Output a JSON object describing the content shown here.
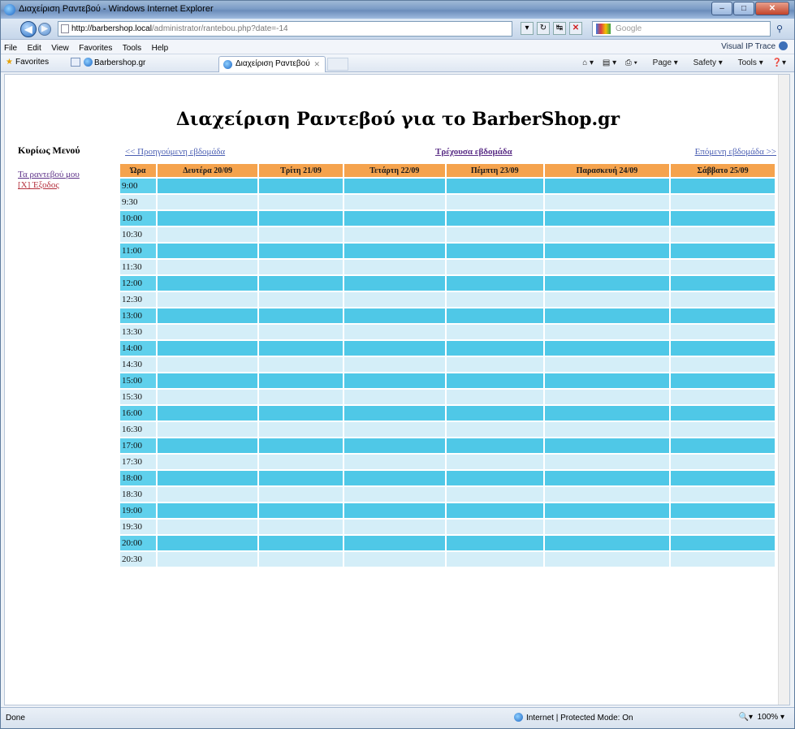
{
  "browser": {
    "window_title": "Διαχείριση Ραντεβού - Windows Internet Explorer",
    "address_host": "http://barbershop.local",
    "address_path": "/administrator/rantebou.php?date=-14",
    "search_placeholder": "Google",
    "menu": [
      "File",
      "Edit",
      "View",
      "Favorites",
      "Tools",
      "Help"
    ],
    "visual_ip_trace": "Visual IP Trace",
    "favorites_label": "Favorites",
    "fav_site": "Barbershop.gr",
    "tab_title": "Διαχείριση Ραντεβού",
    "cmd_page": "Page",
    "cmd_safety": "Safety",
    "cmd_tools": "Tools",
    "status_done": "Done",
    "status_zone": "Internet | Protected Mode: On",
    "zoom": "100%"
  },
  "page": {
    "title": "Διαχείριση Ραντεβού για το BarberShop.gr",
    "side_menu": {
      "header": "Κυρίως Μενού",
      "my_appointments": "Τα ραντεβού μου",
      "exit": "[X] Έξοδος"
    },
    "week_nav": {
      "prev": "<< Προηγούμενη εβδομάδα",
      "current": "Τρέχουσα εβδομάδα",
      "next": "Επόμενη εβδομάδα >>"
    },
    "schedule": {
      "time_header": "Ώρα",
      "days": [
        "Δευτέρα 20/09",
        "Τρίτη 21/09",
        "Τετάρτη 22/09",
        "Πέμπτη 23/09",
        "Παρασκευή 24/09",
        "Σάββατο 25/09"
      ],
      "times": [
        "9:00",
        "9:30",
        "10:00",
        "10:30",
        "11:00",
        "11:30",
        "12:00",
        "12:30",
        "13:00",
        "13:30",
        "14:00",
        "14:30",
        "15:00",
        "15:30",
        "16:00",
        "16:30",
        "17:00",
        "17:30",
        "18:00",
        "18:30",
        "19:00",
        "19:30",
        "20:00",
        "20:30"
      ]
    }
  },
  "colors": {
    "header_orange": "#f5a34d",
    "row_dark": "#4fc8e7",
    "row_light": "#d4eef8"
  }
}
